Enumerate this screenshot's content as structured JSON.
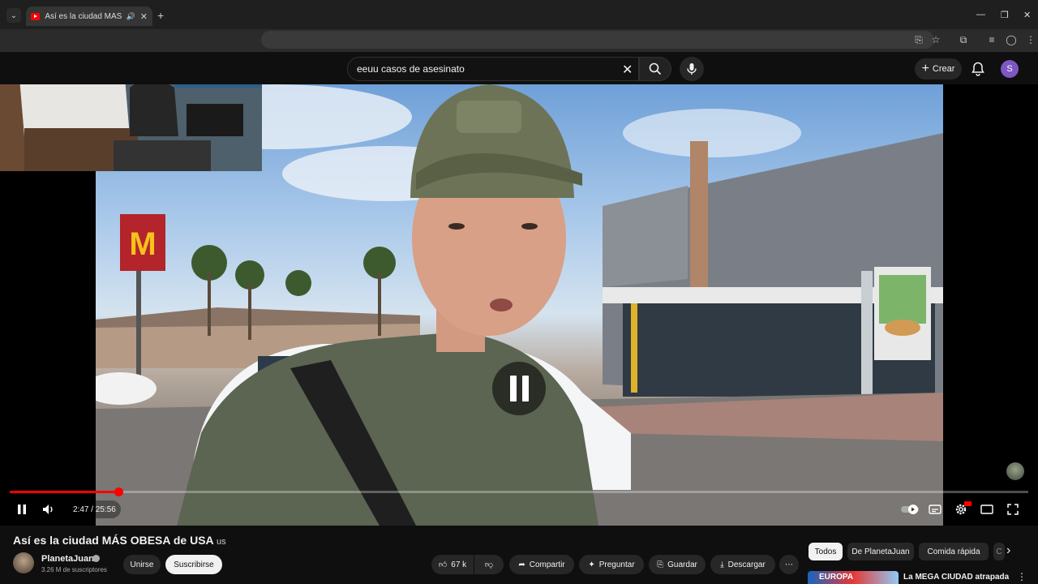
{
  "browser": {
    "tab_title": "Así es la ciudad MÁS OBESA de USA",
    "new_tab": "+",
    "close_tab": "✕",
    "minimize": "—",
    "maximize": "❐",
    "close_window": "✕"
  },
  "masthead": {
    "search_query": "eeuu casos de asesinato",
    "create_label": "Crear",
    "avatar_letter": "S",
    "avatar_color": "#7e57c2"
  },
  "player": {
    "time": "2:47 / 25:56",
    "progress_fraction": 0.107,
    "progress_color": "#ff0000",
    "state": "paused-icon-shown"
  },
  "video": {
    "title": "Así es la ciudad MÁS OBESA de USA",
    "title_flag": "us",
    "channel_name": "PlanetaJuan",
    "subscribers": "3.26 M de suscriptores",
    "join_label": "Unirse",
    "subscribe_label": "Suscribirse",
    "likes": "67 k",
    "share_label": "Compartir",
    "ask_label": "Preguntar",
    "save_label": "Guardar",
    "download_label": "Descargar"
  },
  "chips": [
    "Todos",
    "De PlanetaJuan",
    "Comida rápida",
    "C"
  ],
  "next_video": {
    "thumb_text": "EUROPA",
    "title": "La MEGA CIUDAD atrapada"
  }
}
